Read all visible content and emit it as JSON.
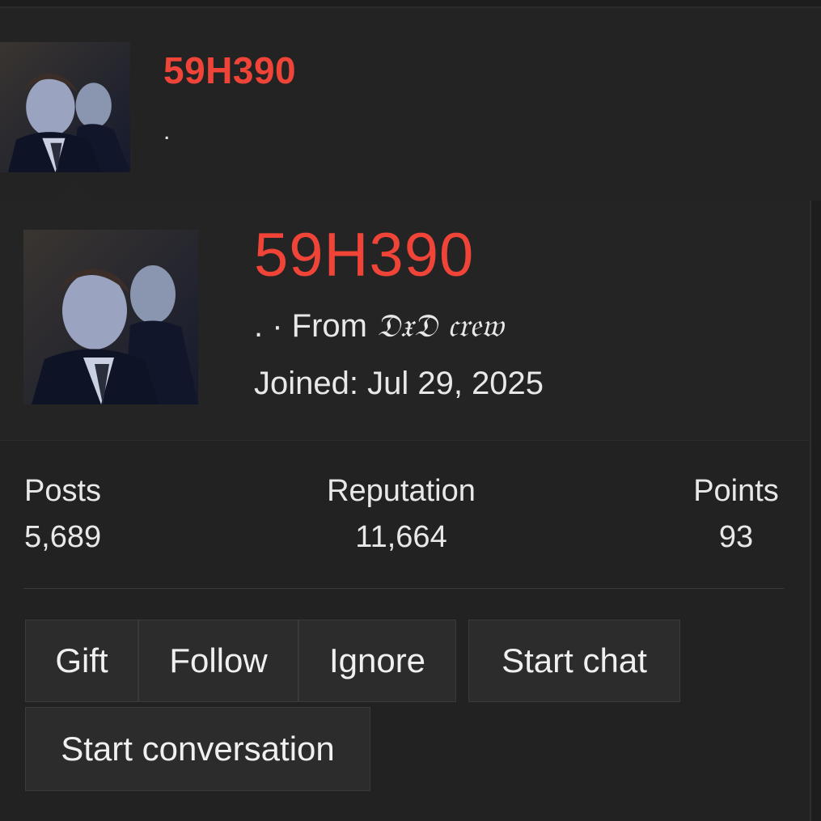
{
  "header": {
    "username": "59H390",
    "subtitle": "."
  },
  "card": {
    "username": "59H390",
    "title_prefix": ". · From ",
    "title_crew": "𝔇𝔵𝔇 𝔠𝔯𝔢𝔴",
    "joined": "Joined: Jul 29, 2025"
  },
  "stats": {
    "posts_label": "Posts",
    "posts_value": "5,689",
    "reputation_label": "Reputation",
    "reputation_value": "11,664",
    "points_label": "Points",
    "points_value": "93"
  },
  "actions": {
    "gift": "Gift",
    "follow": "Follow",
    "ignore": "Ignore",
    "start_chat": "Start chat",
    "start_conversation": "Start conversation"
  },
  "colors": {
    "username": "#f04438",
    "background": "#1d1d1d",
    "card": "#222222",
    "button": "#2c2c2c"
  }
}
